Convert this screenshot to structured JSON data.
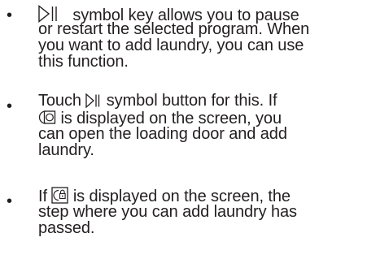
{
  "bullet_marker": "•",
  "items": [
    {
      "lines": [
        {
          "icon": "play-pause-icon",
          "text": "   symbol key allows you to pause"
        },
        {
          "text": "or restart the selected program. When"
        },
        {
          "text": "you want to add laundry, you can use"
        },
        {
          "text": "this function."
        }
      ]
    },
    {
      "lines": [
        {
          "before": "Touch ",
          "icon": "play-pause-icon",
          "text": " symbol button for this. If"
        },
        {
          "icon": "add-laundry-icon",
          "text": " is displayed on the screen, you"
        },
        {
          "text": "can open the loading door and add"
        },
        {
          "text": "laundry."
        }
      ]
    },
    {
      "lines": [
        {
          "before": "If ",
          "icon": "door-locked-icon",
          "text": " is displayed on the screen, the"
        },
        {
          "text": "step where you can add laundry has"
        },
        {
          "text": "passed."
        }
      ]
    }
  ]
}
